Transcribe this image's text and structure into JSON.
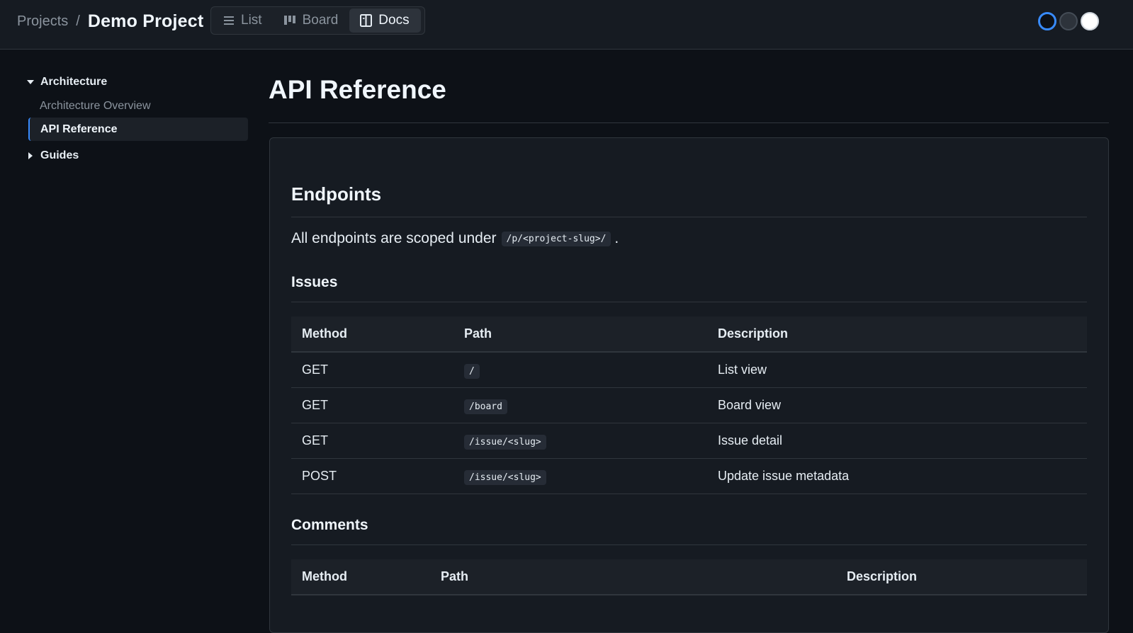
{
  "header": {
    "breadcrumb_root": "Projects",
    "breadcrumb_sep": "/",
    "project_name": "Demo Project",
    "tabs": [
      {
        "label": "List",
        "icon": "list-icon"
      },
      {
        "label": "Board",
        "icon": "board-icon"
      },
      {
        "label": "Docs",
        "icon": "docs-icon",
        "active": true
      }
    ],
    "theme_options": [
      "dark",
      "dim",
      "light"
    ],
    "active_theme": "dark",
    "accent_color": "#388bfd"
  },
  "sidebar": {
    "groups": [
      {
        "label": "Architecture",
        "expanded": true,
        "items": [
          {
            "label": "Architecture Overview",
            "active": false
          },
          {
            "label": "API Reference",
            "active": true
          }
        ]
      },
      {
        "label": "Guides",
        "expanded": false,
        "items": []
      }
    ]
  },
  "main": {
    "title": "API Reference",
    "section_title": "Endpoints",
    "intro_text": "All endpoints are scoped under",
    "intro_code": "/p/<project-slug>/",
    "intro_end": ".",
    "issues": {
      "heading": "Issues",
      "columns": [
        "Method",
        "Path",
        "Description"
      ],
      "rows": [
        {
          "method": "GET",
          "path": "/",
          "description": "List view"
        },
        {
          "method": "GET",
          "path": "/board",
          "description": "Board view"
        },
        {
          "method": "GET",
          "path": "/issue/<slug>",
          "description": "Issue detail"
        },
        {
          "method": "POST",
          "path": "/issue/<slug>",
          "description": "Update issue metadata"
        }
      ]
    },
    "comments": {
      "heading": "Comments",
      "columns": [
        "Method",
        "Path",
        "Description"
      ]
    }
  }
}
